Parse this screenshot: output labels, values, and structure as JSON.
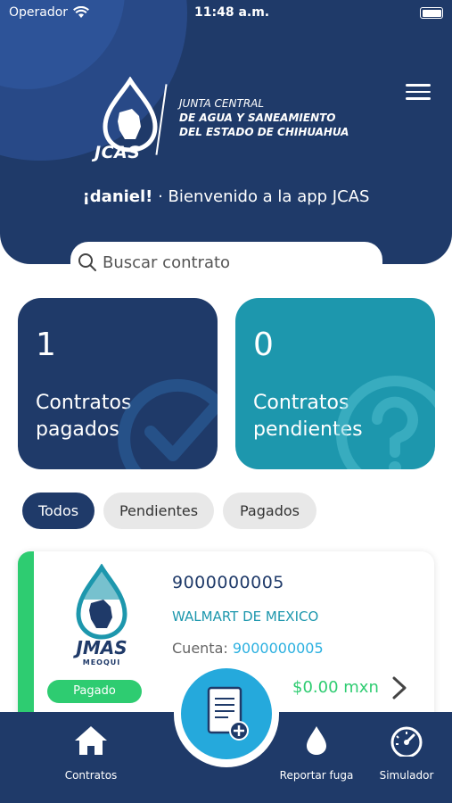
{
  "status_bar": {
    "carrier": "Operador",
    "time": "11:48 a.m."
  },
  "header": {
    "logo_text": "JCAS",
    "org_line1": "JUNTA CENTRAL",
    "org_line2": "DE AGUA Y SANEAMIENTO",
    "org_line3": "DEL ESTADO DE CHIHUAHUA",
    "greeting_name": "¡daniel!",
    "greeting_text": " · Bienvenido a la app JCAS"
  },
  "search": {
    "placeholder": "Buscar contrato"
  },
  "stats": {
    "paid": {
      "count": "1",
      "label_line1": "Contratos",
      "label_line2": "pagados"
    },
    "pending": {
      "count": "0",
      "label_line1": "Contratos",
      "label_line2": "pendientes"
    }
  },
  "filters": [
    "Todos",
    "Pendientes",
    "Pagados"
  ],
  "contract": {
    "logo_text": "JMAS",
    "logo_sub": "MEOQUI",
    "status": "Pagado",
    "number": "9000000005",
    "name": "WALMART DE MEXICO",
    "account_label": "Cuenta: ",
    "account_value": "9000000005",
    "amount": "$0.00 mxn"
  },
  "nav": {
    "contracts": "Contratos",
    "report_leak": "Reportar fuga",
    "simulator": "Simulador"
  },
  "colors": {
    "primary": "#1f3a69",
    "teal": "#1d97ad",
    "green": "#2ecc71",
    "fab": "#25a9dc"
  }
}
